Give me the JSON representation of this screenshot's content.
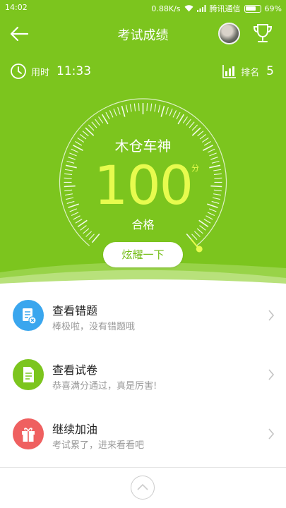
{
  "status_bar": {
    "time": "14:02",
    "network_speed": "0.88K/s",
    "carrier": "腾讯通信",
    "battery": "69%"
  },
  "nav": {
    "title": "考试成绩"
  },
  "stats": {
    "time_label": "用时",
    "time_value": "11:33",
    "rank_label": "排名",
    "rank_value": "5"
  },
  "score": {
    "name": "木仓车神",
    "value": "100",
    "unit": "分",
    "status": "合格",
    "fraction": 1.0
  },
  "share_button": "炫耀一下",
  "items": [
    {
      "title": "查看错题",
      "subtitle": "棒极啦，没有错题哦",
      "icon": "wrong-questions-icon",
      "color": "#3aa6ee"
    },
    {
      "title": "查看试卷",
      "subtitle": "恭喜满分通过，真是厉害!",
      "icon": "paper-icon",
      "color": "#7cc51e"
    },
    {
      "title": "继续加油",
      "subtitle": "考试累了，进来看看吧",
      "icon": "gift-icon",
      "color": "#ef6060"
    }
  ],
  "colors": {
    "header_green": "#7cc51e",
    "score_yellow": "#e7fb4e"
  }
}
